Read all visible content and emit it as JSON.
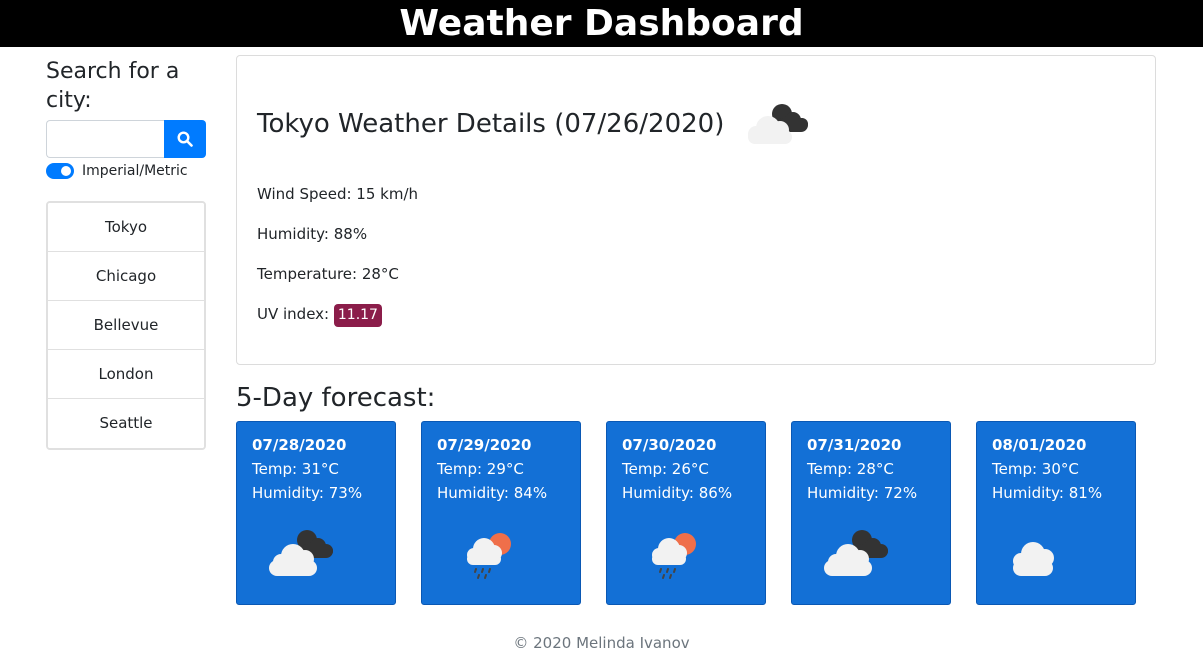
{
  "header": {
    "title": "Weather Dashboard"
  },
  "sidebar": {
    "search_heading": "Search for a city:",
    "search_value": "",
    "toggle_label": "Imperial/Metric",
    "cities": [
      "Tokyo",
      "Chicago",
      "Bellevue",
      "London",
      "Seattle"
    ]
  },
  "details": {
    "title": "Tokyo Weather Details (07/26/2020)",
    "icon": "cloudy-icon",
    "wind": "Wind Speed: 15 km/h",
    "humidity": "Humidity: 88%",
    "temperature": "Temperature: 28°C",
    "uv_label": "UV index: ",
    "uv_value": "11.17",
    "uv_color": "#8b1d4a"
  },
  "forecast": {
    "title": "5-Day forecast:",
    "days": [
      {
        "date": "07/28/2020",
        "temp": "Temp: 31°C",
        "humidity": "Humidity: 73%",
        "icon": "cloudy-icon"
      },
      {
        "date": "07/29/2020",
        "temp": "Temp: 29°C",
        "humidity": "Humidity: 84%",
        "icon": "rain-sun-icon"
      },
      {
        "date": "07/30/2020",
        "temp": "Temp: 26°C",
        "humidity": "Humidity: 86%",
        "icon": "rain-sun-icon"
      },
      {
        "date": "07/31/2020",
        "temp": "Temp: 28°C",
        "humidity": "Humidity: 72%",
        "icon": "cloudy-icon"
      },
      {
        "date": "08/01/2020",
        "temp": "Temp: 30°C",
        "humidity": "Humidity: 81%",
        "icon": "cloud-icon"
      }
    ]
  },
  "footer": {
    "text": "© 2020 Melinda Ivanov"
  },
  "colors": {
    "accent": "#007bff",
    "card": "#1370d6",
    "header": "#000000"
  }
}
